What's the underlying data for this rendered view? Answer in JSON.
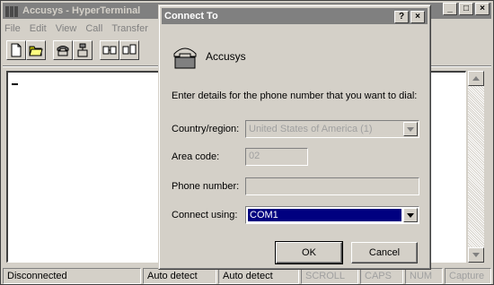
{
  "main_window": {
    "title": "Accusys - HyperTerminal",
    "menu": [
      "File",
      "Edit",
      "View",
      "Call",
      "Transfer"
    ],
    "caption_buttons": [
      "_",
      "□",
      "×"
    ]
  },
  "statusbar": {
    "cells": [
      "Disconnected",
      "Auto detect",
      "Auto detect",
      "SCROLL",
      "CAPS",
      "NUM",
      "Capture"
    ]
  },
  "dialog": {
    "title": "Connect To",
    "caption_buttons": [
      "?",
      "×"
    ],
    "connection_name": "Accusys",
    "instructions": "Enter details for the phone number that you want to dial:",
    "country_label": "Country/region:",
    "country_value": "United States of America (1)",
    "area_code_label": "Area code:",
    "area_code_value": "02",
    "phone_label": "Phone number:",
    "phone_value": "",
    "connect_using_label": "Connect using:",
    "connect_using_value": "COM1",
    "ok_label": "OK",
    "cancel_label": "Cancel"
  }
}
